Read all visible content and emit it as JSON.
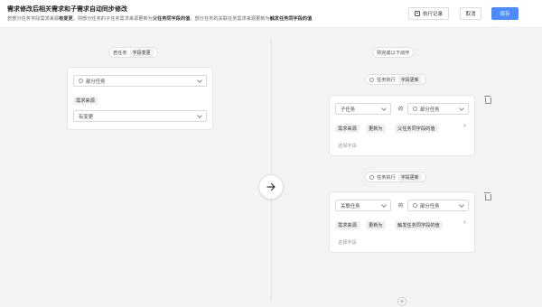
{
  "header": {
    "title": "需求修改后相关需求和子需求自动同步修改",
    "subtitle": {
      "p1": "若部分任务字段需求来源",
      "p2": "有变更",
      "p3": "，则部分任务的子任务需求来源更新为",
      "p4": "父任务同字段的值",
      "p5": "，部分任务的关联任务需求来源更新为",
      "p6": "触发任务同字段的值"
    },
    "log_label": "执行记录",
    "cancel_label": "取消",
    "save_label": "保存"
  },
  "left": {
    "trigger_pill": {
      "prefix": "若任务",
      "tag": "字段变更"
    },
    "task_select": "部分任务",
    "field_tag": "需求来源",
    "condition_select": "有变更"
  },
  "right": {
    "then_pill": "则完成以下动作",
    "action1": {
      "pill_prefix": "任务执行",
      "pill_tag": "字段更新",
      "target_select": "子任务",
      "of_label": "的",
      "source_select": "部分任务",
      "field": "需求来源",
      "update_to": "更新为",
      "value": "父任务同字段的值",
      "choose_field": "选择字段"
    },
    "action2": {
      "pill_prefix": "任务执行",
      "pill_tag": "字段更新",
      "target_select": "关联任务",
      "of_label": "的",
      "source_select": "部分任务",
      "field": "需求来源",
      "update_to": "更新为",
      "value": "触发任务同字段的值",
      "choose_field": "选择字段"
    }
  },
  "colors": {
    "primary": "#4a8cff",
    "canvas": "#f4f4f5"
  }
}
